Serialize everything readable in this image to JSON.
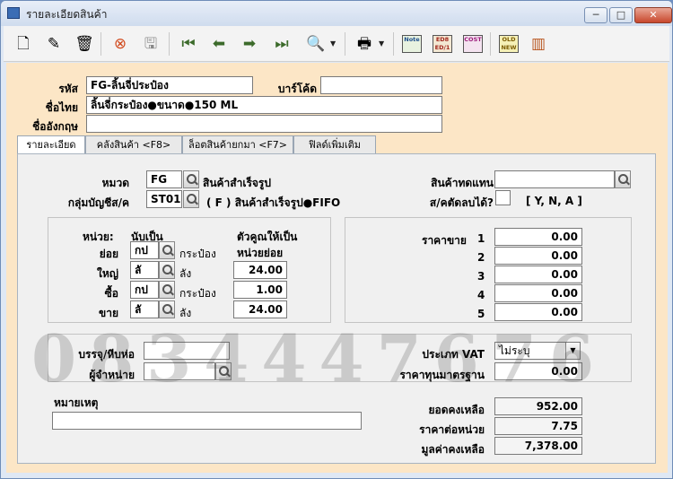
{
  "window": {
    "title": "รายละเอียดสินค้า",
    "buttons": {
      "minimize": "─",
      "maximize": "□",
      "close": "✕"
    }
  },
  "toolbar": {
    "icons": [
      "new-doc-icon",
      "edit-icon",
      "delete-bin-icon",
      "cancel-icon",
      "save-icon",
      "first-record-icon",
      "prev-record-icon",
      "next-record-icon",
      "last-record-icon",
      "find-icon",
      "print-icon",
      "note-icon",
      "ed1-icon",
      "cost-icon",
      "old-new-icon",
      "barcode-icon"
    ],
    "badges": {
      "note": "Note",
      "ed": "ED8 ED/1",
      "cost": "COST",
      "oldnew": "OLD NEW"
    },
    "dropdown_glyph": "▼"
  },
  "header": {
    "code_label": "รหัส",
    "code_value": "FG-ลิ้นจี่ประป๋อง",
    "barcode_label": "บาร์โค้ด",
    "barcode_value": "",
    "thai_name_label": "ชื่อไทย",
    "thai_name_value": "ลิ้นจี่กระป๋อง●ขนาด●150 ML",
    "english_name_label": "ชื่ออังกฤษ",
    "english_name_value": ""
  },
  "tabs": [
    {
      "label": "รายละเอียด"
    },
    {
      "label": "คลังสินค้า <F8>"
    },
    {
      "label": "ล็อตสินค้ายกมา <F7>"
    },
    {
      "label": "ฟิลด์เพิ่มเติม"
    }
  ],
  "detail": {
    "category_label": "หมวด",
    "category_code": "FG",
    "category_name": "สินค้าสำเร็จรูป",
    "account_group_label": "กลุ่มบัญชีส/ค",
    "account_group_code": "ST01",
    "account_group_desc": "( F )  สินค้าสำเร็จรูป●FIFO",
    "substitute_label": "สินค้าทดแทน",
    "substitute_value": "",
    "discount_label": "ส/คตัดลบได้?",
    "discount_value": "",
    "discount_hint": "[ Y, N, A ]"
  },
  "units": {
    "unit_header": "หน่วย:",
    "count_as_header": "นับเป็น",
    "multiplier_header": "ตัวคูณให้เป็น",
    "multiplier_header2": "หน่วยย่อย",
    "rows": [
      {
        "label": "ย่อย",
        "code": "กป",
        "name": "กระป๋อง",
        "factor": ""
      },
      {
        "label": "ใหญ่",
        "code": "ลั",
        "name": "ลัง",
        "factor": "24.00"
      },
      {
        "label": "ซื้อ",
        "code": "กป",
        "name": "กระป๋อง",
        "factor": "1.00"
      },
      {
        "label": "ขาย",
        "code": "ลั",
        "name": "ลัง",
        "factor": "24.00"
      }
    ]
  },
  "prices": {
    "label": "ราคาขาย",
    "rows": [
      {
        "num": "1",
        "value": "0.00"
      },
      {
        "num": "2",
        "value": "0.00"
      },
      {
        "num": "3",
        "value": "0.00"
      },
      {
        "num": "4",
        "value": "0.00"
      },
      {
        "num": "5",
        "value": "0.00"
      }
    ]
  },
  "packaging": {
    "package_label": "บรรจุ/หีบห่อ",
    "package_value": "",
    "supplier_label": "ผู้จำหน่าย",
    "supplier_value": "",
    "vat_label": "ประเภท VAT",
    "vat_value": "ไม่ระบุ",
    "std_cost_label": "ราคาทุนมาตรฐาน",
    "std_cost_value": "0.00"
  },
  "summary": {
    "remark_label": "หมายเหตุ",
    "remark_value": "",
    "balance_label": "ยอดคงเหลือ",
    "balance_value": "952.00",
    "unit_price_label": "ราคาต่อหน่วย",
    "unit_price_value": "7.75",
    "total_value_label": "มูลค่าคงเหลือ",
    "total_value_value": "7,378.00"
  },
  "watermark": "0834447676"
}
